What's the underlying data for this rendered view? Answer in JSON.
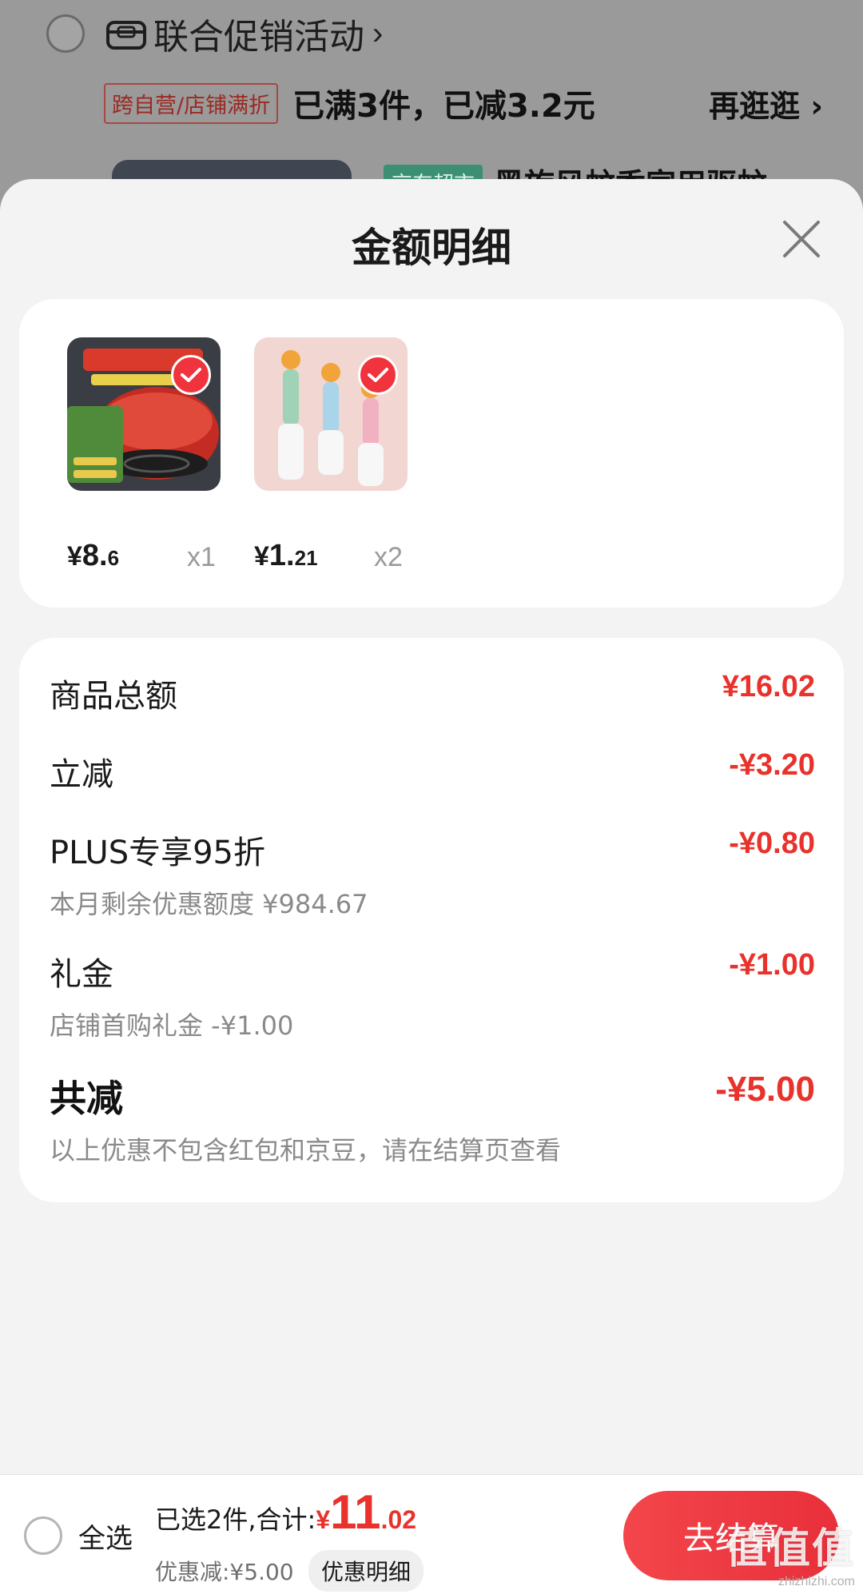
{
  "background": {
    "activity_label": "联合促销活动",
    "promo_tag": "跨自营/店铺满折",
    "promo_text": "已满3件，已减3.2元",
    "more_link": "再逛逛",
    "jd_tag": "京东超市",
    "product_title": "黑旋风蚊香家用驱蚊"
  },
  "sheet": {
    "title": "金额明细",
    "products": [
      {
        "name": "mosquito-coil",
        "price_currency": "¥",
        "price_int": "8.",
        "price_dec": "6",
        "qty": "x1",
        "selected": true
      },
      {
        "name": "cleaning-brush",
        "price_currency": "¥",
        "price_int": "1.",
        "price_dec": "21",
        "qty": "x2",
        "selected": true
      }
    ],
    "rows": {
      "goods_total": {
        "label": "商品总额",
        "value": "¥16.02"
      },
      "instant_discount": {
        "label": "立减",
        "value": "-¥3.20"
      },
      "plus": {
        "label": "PLUS专享95折",
        "value": "-¥0.80",
        "sub": "本月剩余优惠额度 ¥984.67"
      },
      "gift": {
        "label": "礼金",
        "value": "-¥1.00",
        "sub": "店铺首购礼金 -¥1.00"
      },
      "total": {
        "label": "共减",
        "value": "-¥5.00",
        "sub": "以上优惠不包含红包和京豆，请在结算页查看"
      }
    }
  },
  "bottom_bar": {
    "select_all": "全选",
    "summary": "已选2件,合计:",
    "total_currency": "¥",
    "total_int": "11",
    "total_dec": ".02",
    "discount": "优惠减:¥5.00",
    "detail_button": "优惠明细",
    "checkout": "去结算"
  },
  "watermark": {
    "main": "值值值",
    "sub": "zhizhizhi.com"
  },
  "colors": {
    "accent_red": "#e8322b",
    "sheet_bg": "#f3f3f3",
    "card_bg": "#ffffff"
  }
}
